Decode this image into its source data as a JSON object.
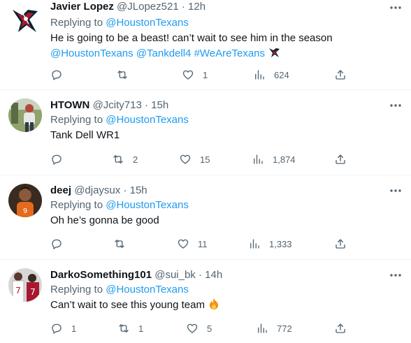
{
  "replying_to_label": "Replying to",
  "tweets": [
    {
      "name": "Javier Lopez",
      "handle": "@JLopez521",
      "dot": "·",
      "time": "12h",
      "replying_to": "@HoustonTexans",
      "text_line1": "He is going to be a beast! can’t wait to see him in the season",
      "mentions": [
        "@HoustonTexans",
        "@Tankdell4",
        "#WeAreTexans"
      ],
      "replies": "",
      "retweets": "",
      "likes": "1",
      "views": "624",
      "avatar_icon": "houston-texans-logo-icon"
    },
    {
      "name": "HTOWN",
      "handle": "@Jcity713",
      "dot": "·",
      "time": "15h",
      "replying_to": "@HoustonTexans",
      "text": "Tank Dell WR1",
      "replies": "",
      "retweets": "2",
      "likes": "15",
      "views": "1,874",
      "avatar_icon": "football-player-photo-icon"
    },
    {
      "name": "deej",
      "handle": "@djaysux",
      "dot": "·",
      "time": "15h",
      "replying_to": "@HoustonTexans",
      "text": "Oh he’s gonna be good",
      "replies": "",
      "retweets": "",
      "likes": "11",
      "views": "1,333",
      "avatar_icon": "person-orange-jersey-photo-icon"
    },
    {
      "name": "DarkoSomething101",
      "handle": "@sui_bk",
      "dot": "·",
      "time": "14h",
      "replying_to": "@HoustonTexans",
      "text": "Can’t wait to see this young team",
      "replies": "1",
      "retweets": "1",
      "likes": "5",
      "views": "772",
      "avatar_icon": "players-number-seven-photo-icon"
    }
  ],
  "colors": {
    "link": "#1d9bf0",
    "secondary_text": "#536471",
    "primary_text": "#0f1419",
    "divider": "#eff3f4"
  },
  "icons": [
    "more-icon",
    "reply-icon",
    "retweet-icon",
    "like-icon",
    "views-icon",
    "share-icon",
    "texans-flag-emoji",
    "fire-emoji"
  ]
}
